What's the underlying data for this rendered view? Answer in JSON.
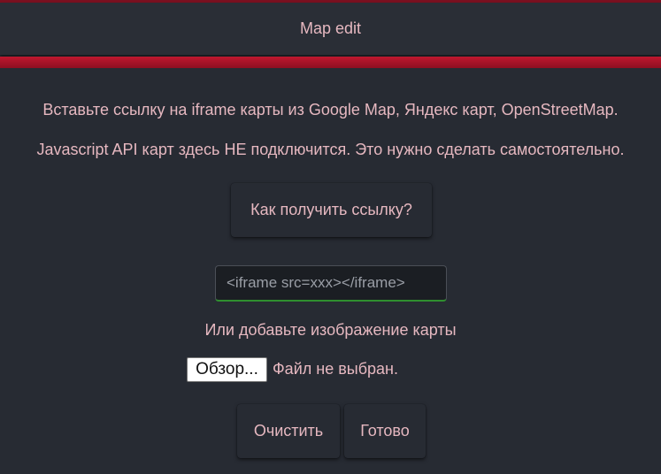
{
  "header": {
    "title": "Map edit"
  },
  "main": {
    "instruction": "Вставьте ссылку на iframe карты из Google Map, Яндекс карт, OpenStreetMap.",
    "warning": "Javascript API карт здесь НЕ подключится. Это нужно сделать самостоятельно.",
    "help_button_label": "Как получить ссылку?",
    "iframe_input": {
      "value": "",
      "placeholder": "<iframe src=xxx></iframe>"
    },
    "or_text": "Или добавьте изображение карты",
    "file_button_label": "Обзор...",
    "file_status": "Файл не выбран.",
    "clear_button_label": "Очистить",
    "done_button_label": "Готово"
  },
  "colors": {
    "accent": "#c0172e",
    "background": "#272b33",
    "text": "#e6b8c0",
    "input_focus_border": "#2f8f2f"
  }
}
